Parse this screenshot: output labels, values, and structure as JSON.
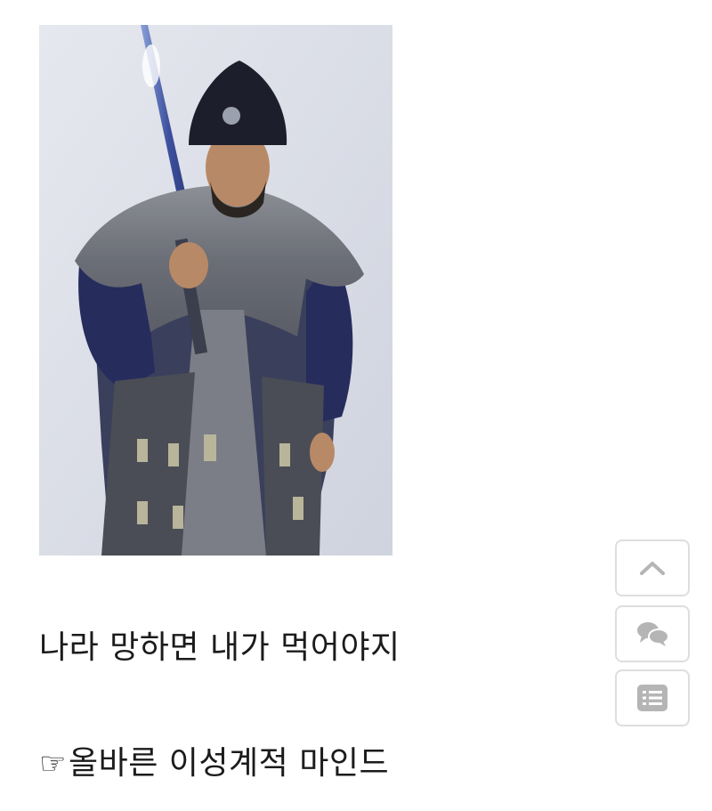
{
  "post": {
    "image_icon": "portrait-photo",
    "line1": "나라 망하면 내가 먹어야지",
    "line2_icon": "☞",
    "line2_text": "올바른 이성계적 마인드"
  },
  "floating_buttons": [
    {
      "icon": "chevron-up-icon"
    },
    {
      "icon": "chat-bubbles-icon"
    },
    {
      "icon": "list-icon"
    }
  ],
  "colors": {
    "button_border": "#dedede",
    "icon_gray": "#b5b5b5",
    "photo_background": "#dcdfe8"
  }
}
